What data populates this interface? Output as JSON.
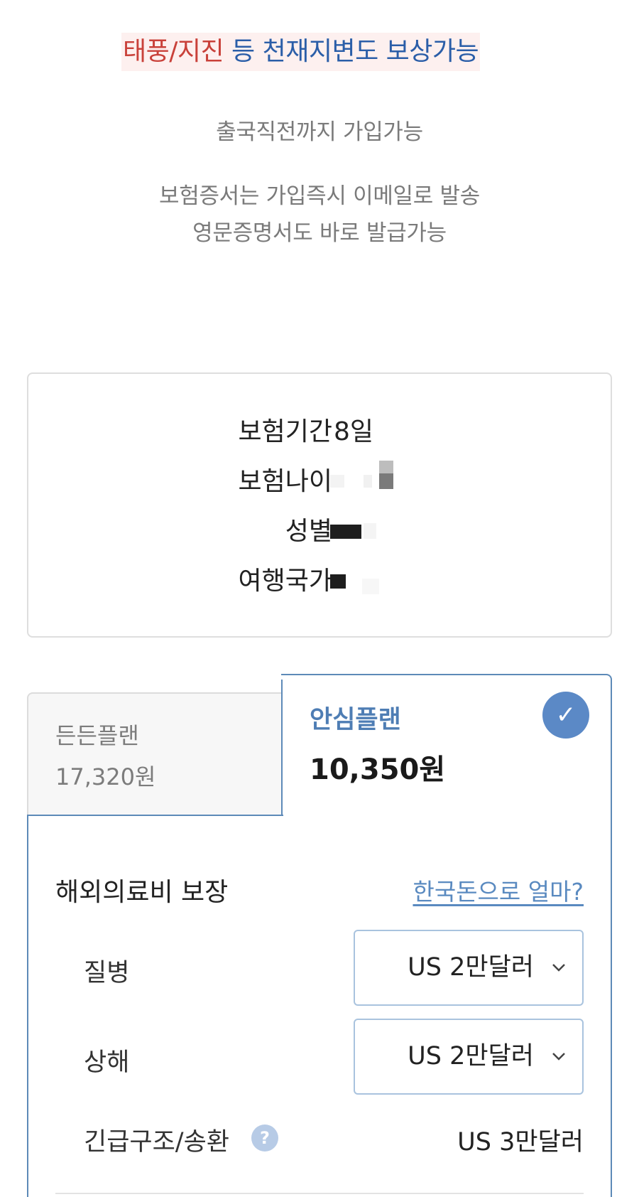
{
  "headline": {
    "red_text": "태풍/지진",
    "blue_text": " 등 천재지변도 보상가능"
  },
  "notices": {
    "line1": "출국직전까지 가입가능",
    "line2": "보험증서는 가입즉시 이메일로 발송",
    "line3": "영문증명서도 바로 발급가능"
  },
  "summary": {
    "rows": [
      {
        "label": "보험기간",
        "value": "8일"
      },
      {
        "label": "보험나이",
        "value": ""
      },
      {
        "label": "성별",
        "value": ""
      },
      {
        "label": "여행국가",
        "value": ""
      }
    ]
  },
  "plans": {
    "inactive": {
      "name": "든든플랜",
      "price": "17,320원"
    },
    "active": {
      "name": "안심플랜",
      "price": "10,350원"
    }
  },
  "coverage": {
    "title": "해외의료비 보장",
    "krw_link": "한국돈으로 얼마?",
    "items": [
      {
        "label": "질병",
        "value": "US 2만달러"
      },
      {
        "label": "상해",
        "value": "US 2만달러"
      }
    ],
    "emergency": {
      "label": "긴급구조/송환",
      "help": "?",
      "value": "US 3만달러"
    }
  },
  "colors": {
    "accent_blue": "#5d8ab8",
    "headline_red": "#c9413a",
    "headline_blue": "#2b5ea8"
  },
  "icons": {
    "check": "check-icon",
    "chevron": "chevron-down-icon",
    "help": "question-icon"
  }
}
